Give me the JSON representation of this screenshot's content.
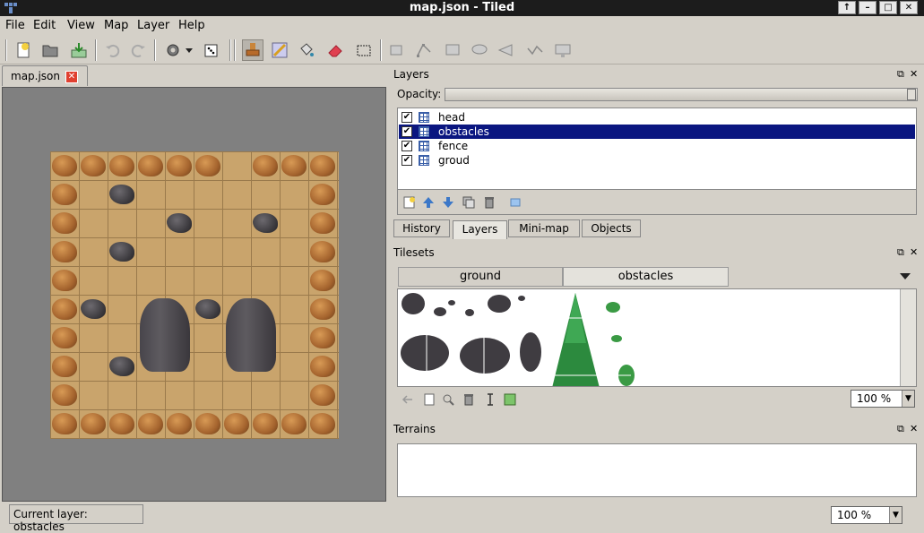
{
  "window": {
    "title": "map.json - Tiled",
    "buttons": [
      "↑",
      "–",
      "□",
      "✕"
    ]
  },
  "menu": [
    "File",
    "Edit",
    "View",
    "Map",
    "Layer",
    "Help"
  ],
  "document_tab": {
    "label": "map.json",
    "close": "✕"
  },
  "layers_panel": {
    "title": "Layers",
    "opacity_label": "Opacity:",
    "opacity_value": 1.0,
    "layers": [
      {
        "name": "head",
        "visible": true,
        "selected": false
      },
      {
        "name": "obstacles",
        "visible": true,
        "selected": true
      },
      {
        "name": "fence",
        "visible": true,
        "selected": false
      },
      {
        "name": "groud",
        "visible": true,
        "selected": false
      }
    ]
  },
  "dock_tabs": [
    {
      "label": "History",
      "active": false
    },
    {
      "label": "Layers",
      "active": true
    },
    {
      "label": "Mini-map",
      "active": false
    },
    {
      "label": "Objects",
      "active": false
    }
  ],
  "tilesets_panel": {
    "title": "Tilesets",
    "tabs": [
      {
        "label": "ground",
        "active": false
      },
      {
        "label": "obstacles",
        "active": true
      }
    ],
    "zoom": "100 %"
  },
  "terrains_panel": {
    "title": "Terrains"
  },
  "status": {
    "current_layer": "Current layer: obstacles",
    "zoom": "100 %"
  },
  "colors": {
    "selection": "#0a1680",
    "titlebar": "#1c1c1c",
    "chrome": "#d4d0c8"
  }
}
